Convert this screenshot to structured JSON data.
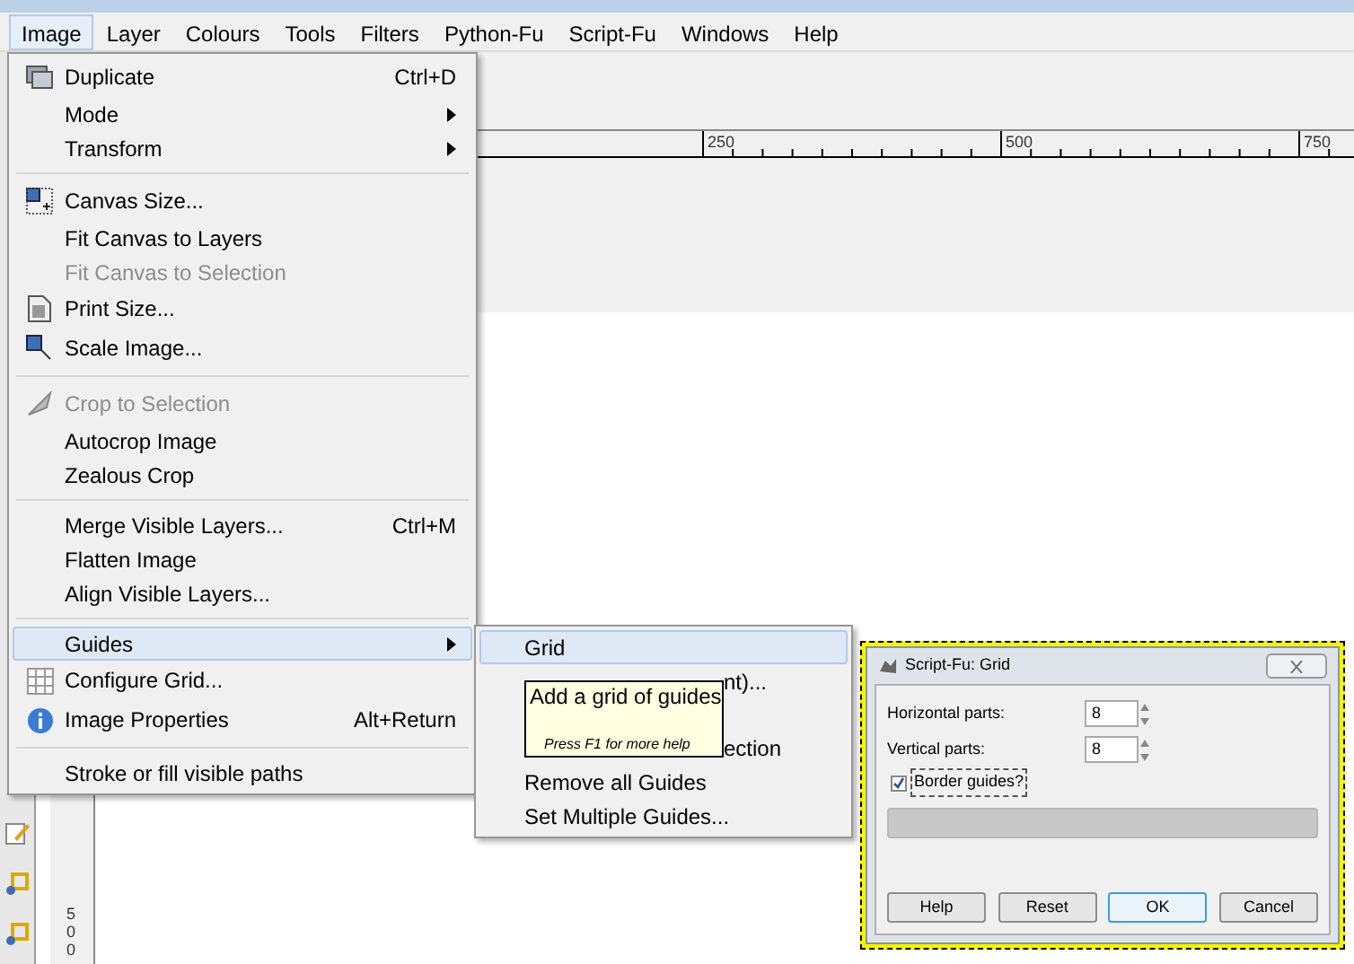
{
  "menubar": [
    {
      "label": "Image",
      "selected": true
    },
    {
      "label": "Layer",
      "selected": false
    },
    {
      "label": "Colours",
      "selected": false
    },
    {
      "label": "Tools",
      "selected": false
    },
    {
      "label": "Filters",
      "selected": false
    },
    {
      "label": "Python-Fu",
      "selected": false
    },
    {
      "label": "Script-Fu",
      "selected": false
    },
    {
      "label": "Windows",
      "selected": false
    },
    {
      "label": "Help",
      "selected": false
    }
  ],
  "ruler": {
    "labels": [
      "250",
      "500",
      "750"
    ]
  },
  "vertical_ruler": {
    "label": "500"
  },
  "image_menu": [
    {
      "kind": "item",
      "label": "Duplicate",
      "shortcut": "Ctrl+D",
      "disabled": false,
      "selected": false
    },
    {
      "kind": "submenu",
      "label": "Mode",
      "disabled": false,
      "selected": false
    },
    {
      "kind": "submenu",
      "label": "Transform",
      "disabled": false,
      "selected": false
    },
    {
      "kind": "separator"
    },
    {
      "kind": "item",
      "label": "Canvas Size...",
      "disabled": false,
      "selected": false
    },
    {
      "kind": "item",
      "label": "Fit Canvas to Layers",
      "disabled": false,
      "selected": false
    },
    {
      "kind": "item",
      "label": "Fit Canvas to Selection",
      "disabled": true,
      "selected": false
    },
    {
      "kind": "item",
      "label": "Print Size...",
      "disabled": false,
      "selected": false
    },
    {
      "kind": "item",
      "label": "Scale Image...",
      "disabled": false,
      "selected": false
    },
    {
      "kind": "separator"
    },
    {
      "kind": "item",
      "label": "Crop to Selection",
      "disabled": true,
      "selected": false
    },
    {
      "kind": "item",
      "label": "Autocrop Image",
      "disabled": false,
      "selected": false
    },
    {
      "kind": "item",
      "label": "Zealous Crop",
      "disabled": false,
      "selected": false
    },
    {
      "kind": "separator"
    },
    {
      "kind": "item",
      "label": "Merge Visible Layers...",
      "shortcut": "Ctrl+M",
      "disabled": false,
      "selected": false
    },
    {
      "kind": "item",
      "label": "Flatten Image",
      "disabled": false,
      "selected": false
    },
    {
      "kind": "item",
      "label": "Align Visible Layers...",
      "disabled": false,
      "selected": false
    },
    {
      "kind": "separator"
    },
    {
      "kind": "submenu",
      "label": "Guides",
      "disabled": false,
      "selected": true
    },
    {
      "kind": "item",
      "label": "Configure Grid...",
      "disabled": false,
      "selected": false
    },
    {
      "kind": "item",
      "label": "Image Properties",
      "shortcut": "Alt+Return",
      "disabled": false,
      "selected": false
    },
    {
      "kind": "separator"
    },
    {
      "kind": "item",
      "label": "Stroke or fill visible paths",
      "disabled": false,
      "selected": false
    }
  ],
  "guides_submenu": [
    {
      "label": "Grid",
      "selected": true
    },
    {
      "label": "nt)...",
      "selected": false
    },
    {
      "selected": false
    },
    {
      "label": "ection",
      "selected": false
    },
    {
      "label": "Remove all Guides",
      "selected": false
    },
    {
      "label": "Set Multiple Guides...",
      "selected": false
    }
  ],
  "tooltip": {
    "title": "Add a grid of guides",
    "hint": "Press F1 for more help"
  },
  "dialog": {
    "title": "Script-Fu: Grid",
    "fields": [
      {
        "label": "Horizontal parts:",
        "value": "8"
      },
      {
        "label": "Vertical parts:",
        "value": "8"
      }
    ],
    "checkbox": {
      "label": "Border guides?",
      "checked": true
    },
    "progress": {
      "level": 0
    },
    "buttons": [
      {
        "label": "Help",
        "selected": false
      },
      {
        "label": "Reset",
        "selected": false
      },
      {
        "label": "OK",
        "selected": true
      },
      {
        "label": "Cancel",
        "selected": false
      }
    ]
  }
}
